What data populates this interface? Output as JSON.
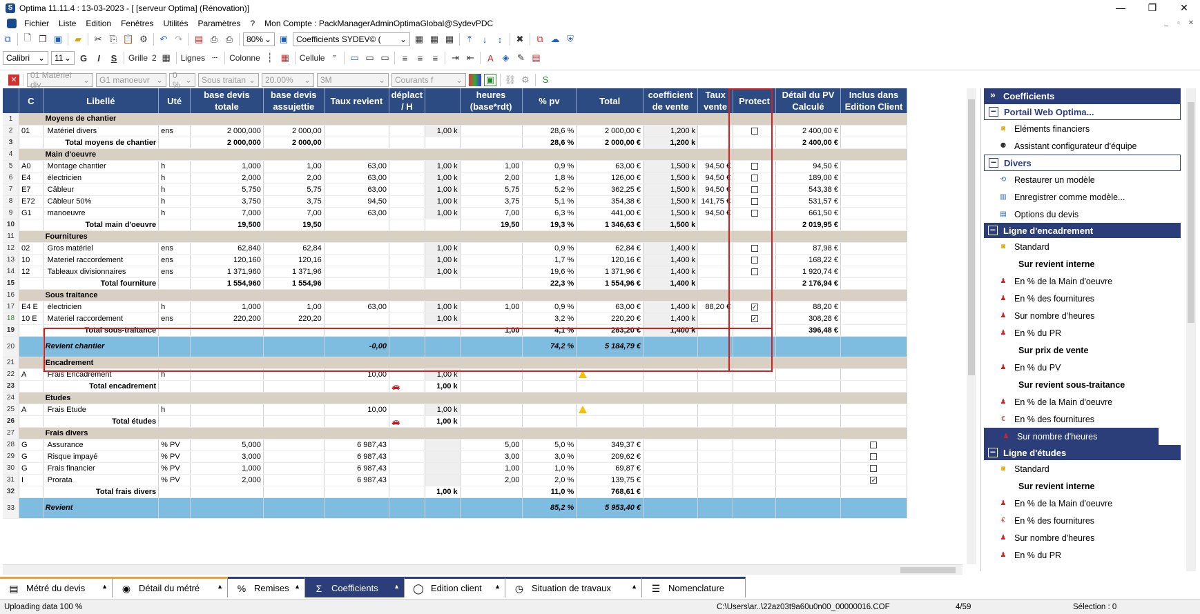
{
  "window": {
    "title": "Optima 11.11.4 : 13-03-2023 - [ [serveur Optima] (Rénovation)]",
    "minimize": "—",
    "maximize": "❐",
    "close": "✕"
  },
  "menu": [
    "Fichier",
    "Liste",
    "Edition",
    "Fenêtres",
    "Utilités",
    "Paramètres",
    "?"
  ],
  "account": "Mon Compte : PackManagerAdminOptimaGlobal@SydevPDC",
  "toolbar1": {
    "zoom": "80%",
    "coeff_select": "Coefficients  SYDEV© ("
  },
  "toolbar2": {
    "font": "Calibri",
    "size": "11",
    "bold": "G",
    "italic": "I",
    "strike": "S",
    "grille": "Grille",
    "grille_val": "2",
    "lignes": "Lignes",
    "colonne": "Colonne",
    "cellule": "Cellule"
  },
  "toolbar3": {
    "materiel": "01  Matériel div",
    "manoeuvre": "G1  manoeuvr",
    "zero": "0 %",
    "sous": "Sous traitan",
    "pct": "20.00%",
    "threem": "3M",
    "courants": "Courants f"
  },
  "columns": [
    "C",
    "Libellé",
    "Uté",
    "base devis totale",
    "base devis assujettie",
    "Taux revient",
    "déplact / H",
    "",
    "heures (base*rdt)",
    "% pv",
    "Total",
    "coefficient de vente",
    "Taux vente",
    "Protect",
    "Détail du PV Calculé",
    "Inclus dans Edition Client"
  ],
  "rows": [
    {
      "n": "1",
      "type": "sec",
      "c": "",
      "lib": "Moyens de chantier"
    },
    {
      "n": "2",
      "c": "01",
      "lib": "Matériel divers",
      "u": "ens",
      "bdt": "2 000,000",
      "bda": "2 000,00",
      "tr": "",
      "dep": "",
      "k": "1,00 k",
      "h": "",
      "pv": "28,6 %",
      "tot": "2 000,00 €",
      "cv": "1,200 k",
      "tv": "",
      "prot": "off",
      "det": "2 400,00 €",
      "inc": ""
    },
    {
      "n": "3",
      "type": "tot",
      "c": "",
      "lib": "Total moyens de chantier",
      "u": "",
      "bdt": "2 000,000",
      "bda": "2 000,00",
      "tr": "",
      "dep": "",
      "k": "",
      "h": "",
      "pv": "28,6 %",
      "tot": "2 000,00 €",
      "cv": "1,200 k",
      "tv": "",
      "prot": "",
      "det": "2 400,00 €",
      "inc": ""
    },
    {
      "n": "4",
      "type": "sec",
      "c": "",
      "lib": "Main d'oeuvre"
    },
    {
      "n": "5",
      "c": "A0",
      "lib": "Montage chantier",
      "u": "h",
      "bdt": "1,000",
      "bda": "1,00",
      "tr": "63,00",
      "dep": "",
      "k": "1,00 k",
      "h": "1,00",
      "pv": "0,9 %",
      "tot": "63,00 €",
      "cv": "1,500 k",
      "tv": "94,50 €",
      "prot": "off",
      "det": "94,50 €",
      "inc": ""
    },
    {
      "n": "6",
      "c": "E4",
      "lib": "électricien",
      "u": "h",
      "bdt": "2,000",
      "bda": "2,00",
      "tr": "63,00",
      "dep": "",
      "k": "1,00 k",
      "h": "2,00",
      "pv": "1,8 %",
      "tot": "126,00 €",
      "cv": "1,500 k",
      "tv": "94,50 €",
      "prot": "off",
      "det": "189,00 €",
      "inc": ""
    },
    {
      "n": "7",
      "c": "E7",
      "lib": "Câbleur",
      "u": "h",
      "bdt": "5,750",
      "bda": "5,75",
      "tr": "63,00",
      "dep": "",
      "k": "1,00 k",
      "h": "5,75",
      "pv": "5,2 %",
      "tot": "362,25 €",
      "cv": "1,500 k",
      "tv": "94,50 €",
      "prot": "off",
      "det": "543,38 €",
      "inc": ""
    },
    {
      "n": "8",
      "c": "E72",
      "lib": "Câbleur 50%",
      "u": "h",
      "bdt": "3,750",
      "bda": "3,75",
      "tr": "94,50",
      "dep": "",
      "k": "1,00 k",
      "h": "3,75",
      "pv": "5,1 %",
      "tot": "354,38 €",
      "cv": "1,500 k",
      "tv": "141,75 €",
      "prot": "off",
      "det": "531,57 €",
      "inc": ""
    },
    {
      "n": "9",
      "c": "G1",
      "lib": "manoeuvre",
      "u": "h",
      "bdt": "7,000",
      "bda": "7,00",
      "tr": "63,00",
      "dep": "",
      "k": "1,00 k",
      "h": "7,00",
      "pv": "6,3 %",
      "tot": "441,00 €",
      "cv": "1,500 k",
      "tv": "94,50 €",
      "prot": "off",
      "det": "661,50 €",
      "inc": ""
    },
    {
      "n": "10",
      "type": "tot",
      "c": "",
      "lib": "Total main d'oeuvre",
      "u": "",
      "bdt": "19,500",
      "bda": "19,50",
      "tr": "",
      "dep": "",
      "k": "",
      "h": "19,50",
      "pv": "19,3 %",
      "tot": "1 346,63 €",
      "cv": "1,500 k",
      "tv": "",
      "prot": "",
      "det": "2 019,95 €",
      "inc": ""
    },
    {
      "n": "11",
      "type": "sec",
      "c": "",
      "lib": "Fournitures"
    },
    {
      "n": "12",
      "c": "02",
      "lib": "Gros matériel",
      "u": "ens",
      "bdt": "62,840",
      "bda": "62,84",
      "tr": "",
      "dep": "",
      "k": "1,00 k",
      "h": "",
      "pv": "0,9 %",
      "tot": "62,84 €",
      "cv": "1,400 k",
      "tv": "",
      "prot": "off",
      "det": "87,98 €",
      "inc": ""
    },
    {
      "n": "13",
      "c": "10",
      "lib": "Materiel raccordement",
      "u": "ens",
      "bdt": "120,160",
      "bda": "120,16",
      "tr": "",
      "dep": "",
      "k": "1,00 k",
      "h": "",
      "pv": "1,7 %",
      "tot": "120,16 €",
      "cv": "1,400 k",
      "tv": "",
      "prot": "off",
      "det": "168,22 €",
      "inc": ""
    },
    {
      "n": "14",
      "c": "12",
      "lib": "Tableaux divisionnaires",
      "u": "ens",
      "bdt": "1 371,960",
      "bda": "1 371,96",
      "tr": "",
      "dep": "",
      "k": "1,00 k",
      "h": "",
      "pv": "19,6 %",
      "tot": "1 371,96 €",
      "cv": "1,400 k",
      "tv": "",
      "prot": "off",
      "det": "1 920,74 €",
      "inc": ""
    },
    {
      "n": "15",
      "type": "tot",
      "c": "",
      "lib": "Total fourniture",
      "u": "",
      "bdt": "1 554,960",
      "bda": "1 554,96",
      "tr": "",
      "dep": "",
      "k": "",
      "h": "",
      "pv": "22,3 %",
      "tot": "1 554,96 €",
      "cv": "1,400 k",
      "tv": "",
      "prot": "",
      "det": "2 176,94 €",
      "inc": ""
    },
    {
      "n": "16",
      "type": "sec",
      "c": "",
      "lib": "Sous traitance"
    },
    {
      "n": "17",
      "c": "E4 E",
      "lib": "électricien",
      "u": "h",
      "bdt": "1,000",
      "bda": "1,00",
      "tr": "63,00",
      "dep": "",
      "k": "1,00 k",
      "h": "1,00",
      "pv": "0,9 %",
      "tot": "63,00 €",
      "cv": "1,400 k",
      "tv": "88,20 €",
      "prot": "on",
      "det": "88,20 €",
      "inc": ""
    },
    {
      "n": "18",
      "c": "10 E",
      "lib": "Materiel raccordement",
      "u": "ens",
      "bdt": "220,200",
      "bda": "220,20",
      "tr": "",
      "dep": "",
      "k": "1,00 k",
      "h": "",
      "pv": "3,2 %",
      "tot": "220,20 €",
      "cv": "1,400 k",
      "tv": "",
      "prot": "on",
      "det": "308,28 €",
      "inc": ""
    },
    {
      "n": "19",
      "type": "tot",
      "c": "",
      "lib": "Total sous-traitance",
      "u": "",
      "bdt": "",
      "bda": "",
      "tr": "",
      "dep": "",
      "k": "",
      "h": "1,00",
      "pv": "4,1 %",
      "tot": "283,20 €",
      "cv": "1,400 k",
      "tv": "",
      "prot": "",
      "det": "396,48 €",
      "inc": ""
    },
    {
      "n": "20",
      "type": "big",
      "c": "",
      "lib": "Revient chantier",
      "tr": "-0,00",
      "pv": "74,2 %",
      "tot": "5 184,79 €"
    },
    {
      "n": "21",
      "type": "sec",
      "c": "",
      "lib": "Encadrement"
    },
    {
      "n": "22",
      "c": "A",
      "lib": "Frais Encadrement",
      "u": "h",
      "bdt": "",
      "bda": "",
      "tr": "10,00",
      "dep": "",
      "k": "1,00 k",
      "h": "",
      "pv": "",
      "tot": "warn",
      "cv": "",
      "tv": "",
      "prot": "",
      "det": "",
      "inc": ""
    },
    {
      "n": "23",
      "type": "tot",
      "c": "",
      "lib": "Total encadrement",
      "u": "",
      "bdt": "",
      "bda": "",
      "tr": "",
      "dep": "car",
      "k": "1,00 k",
      "h": "",
      "pv": "box",
      "tot": "box",
      "cv": "",
      "tv": "",
      "prot": "",
      "det": "",
      "inc": ""
    },
    {
      "n": "24",
      "type": "sec",
      "c": "",
      "lib": "Etudes"
    },
    {
      "n": "25",
      "c": "A",
      "lib": "Frais Etude",
      "u": "h",
      "bdt": "",
      "bda": "",
      "tr": "10,00",
      "dep": "",
      "k": "1,00 k",
      "h": "",
      "pv": "",
      "tot": "warn",
      "cv": "",
      "tv": "",
      "prot": "",
      "det": "",
      "inc": ""
    },
    {
      "n": "26",
      "type": "tot",
      "c": "",
      "lib": "Total études",
      "u": "",
      "bdt": "",
      "bda": "",
      "tr": "",
      "dep": "car",
      "k": "1,00 k",
      "h": "",
      "pv": "box",
      "tot": "box",
      "cv": "",
      "tv": "",
      "prot": "",
      "det": "",
      "inc": ""
    },
    {
      "n": "27",
      "type": "sec",
      "c": "",
      "lib": "Frais divers"
    },
    {
      "n": "28",
      "c": "G",
      "lib": "Assurance",
      "u": "% PV",
      "bdt": "5,000",
      "bda": "",
      "tr": "6 987,43",
      "dep": "",
      "k": "",
      "h": "5,00",
      "pv": "5,0 %",
      "tot": "349,37 €",
      "cv": "",
      "tv": "",
      "prot": "",
      "det": "",
      "inc": "off"
    },
    {
      "n": "29",
      "c": "G",
      "lib": "Risque impayé",
      "u": "% PV",
      "bdt": "3,000",
      "bda": "",
      "tr": "6 987,43",
      "dep": "",
      "k": "",
      "h": "3,00",
      "pv": "3,0 %",
      "tot": "209,62 €",
      "cv": "",
      "tv": "",
      "prot": "",
      "det": "",
      "inc": "off"
    },
    {
      "n": "30",
      "c": "G",
      "lib": "Frais financier",
      "u": "% PV",
      "bdt": "1,000",
      "bda": "",
      "tr": "6 987,43",
      "dep": "",
      "k": "",
      "h": "1,00",
      "pv": "1,0 %",
      "tot": "69,87 €",
      "cv": "",
      "tv": "",
      "prot": "",
      "det": "",
      "inc": "off"
    },
    {
      "n": "31",
      "c": "I",
      "lib": "Prorata",
      "u": "% PV",
      "bdt": "2,000",
      "bda": "",
      "tr": "6 987,43",
      "dep": "",
      "k": "",
      "h": "2,00",
      "pv": "2,0 %",
      "tot": "139,75 €",
      "cv": "",
      "tv": "",
      "prot": "",
      "det": "",
      "inc": "on"
    },
    {
      "n": "32",
      "type": "tot",
      "c": "",
      "lib": "Total frais divers",
      "u": "",
      "bdt": "",
      "bda": "",
      "tr": "",
      "dep": "",
      "k": "1,00 k",
      "h": "",
      "pv": "11,0 %",
      "tot": "768,61 €",
      "cv": "",
      "tv": "",
      "prot": "",
      "det": "",
      "inc": ""
    },
    {
      "n": "33",
      "type": "big",
      "c": "",
      "lib": "Revient",
      "tr": "",
      "pv": "85,2 %",
      "tot": "5 953,40 €"
    }
  ],
  "panel": [
    {
      "k": "hdr",
      "label": "Coefficients",
      "icon": "»"
    },
    {
      "k": "hdr2",
      "label": "Portail Web Optima..."
    },
    {
      "k": "item",
      "label": "Eléments financiers",
      "icon": "coin"
    },
    {
      "k": "item",
      "label": "Assistant configurateur d'équipe",
      "icon": "team"
    },
    {
      "k": "hdr2",
      "label": "Divers"
    },
    {
      "k": "item",
      "label": "Restaurer un modèle",
      "icon": "restore"
    },
    {
      "k": "item",
      "label": "Enregistrer comme modèle...",
      "icon": "save"
    },
    {
      "k": "item",
      "label": "Options du devis",
      "icon": "options"
    },
    {
      "k": "hdr",
      "label": "Ligne d'encadrement",
      "icon": "−"
    },
    {
      "k": "item",
      "label": "Standard",
      "icon": "coin"
    },
    {
      "k": "sub",
      "label": "Sur revient interne"
    },
    {
      "k": "item",
      "label": "En % de la Main d'oeuvre",
      "icon": "worker"
    },
    {
      "k": "item",
      "label": "En % des fournitures",
      "icon": "worker"
    },
    {
      "k": "item",
      "label": "Sur nombre d'heures",
      "icon": "worker"
    },
    {
      "k": "item",
      "label": "En % du PR",
      "icon": "worker"
    },
    {
      "k": "sub",
      "label": "Sur prix de vente"
    },
    {
      "k": "item",
      "label": "En % du PV",
      "icon": "worker"
    },
    {
      "k": "sub",
      "label": "Sur revient sous-traitance"
    },
    {
      "k": "item",
      "label": "En % de la Main d'oeuvre",
      "icon": "worker"
    },
    {
      "k": "item",
      "label": "En % des fournitures",
      "icon": "alert"
    },
    {
      "k": "selitem",
      "label": "Sur nombre d'heures",
      "icon": "worker"
    },
    {
      "k": "hdr",
      "label": "Ligne d'études",
      "icon": "−"
    },
    {
      "k": "item",
      "label": "Standard",
      "icon": "coin"
    },
    {
      "k": "sub",
      "label": "Sur revient interne"
    },
    {
      "k": "item",
      "label": "En % de la Main d'oeuvre",
      "icon": "worker"
    },
    {
      "k": "item",
      "label": "En % des fournitures",
      "icon": "alert"
    },
    {
      "k": "item",
      "label": "Sur nombre d'heures",
      "icon": "worker"
    },
    {
      "k": "item",
      "label": "En % du PR",
      "icon": "worker"
    }
  ],
  "tabs": [
    "Métré du devis",
    "Détail du métré",
    "Remises",
    "Coefficients",
    "Edition client",
    "Situation de travaux",
    "Nomenclature"
  ],
  "status": {
    "left": "Uploading data 100 %",
    "path": "C:\\Users\\ar..\\22az03t9a60u0n00_00000016.COF",
    "page": "4/59",
    "selection": "Sélection : 0"
  }
}
